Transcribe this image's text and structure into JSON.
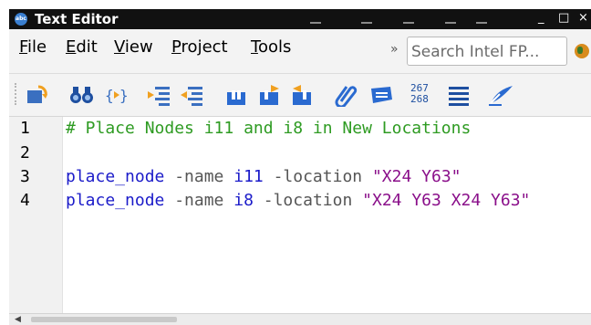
{
  "window": {
    "title": "Text Editor",
    "app_icon_label": "abc",
    "minimize_glyph": "_",
    "maximize_glyph": "□",
    "close_glyph": "×"
  },
  "menu": {
    "items": [
      {
        "underline": "F",
        "rest": "ile"
      },
      {
        "underline": "E",
        "rest": "dit"
      },
      {
        "underline": "V",
        "rest": "iew"
      },
      {
        "underline": "P",
        "rest": "roject"
      },
      {
        "underline": "T",
        "rest": "ools"
      }
    ],
    "overflow_glyph": "»",
    "search_placeholder": "Search Intel FP..."
  },
  "toolbar": {
    "icons": [
      "open-refresh-icon",
      "find-binoculars-icon",
      "braces-icon",
      "indent-icon",
      "outdent-icon",
      "bookmark-icon",
      "bookmark-next-icon",
      "bookmark-prev-icon",
      "attach-paperclip-icon",
      "tag-icon",
      "line-numbers-icon",
      "list-icon",
      "edit-pen-icon"
    ],
    "line_numbers_top": "267",
    "line_numbers_bottom": "268"
  },
  "editor": {
    "line_numbers": [
      "1",
      "2",
      "3",
      "4"
    ],
    "lines": {
      "l1_comment": "# Place Nodes i11 and i8 in New Locations",
      "l3_cmd": "place_node",
      "l3_flag1": " -name ",
      "l3_id": "i11",
      "l3_flag2": " -location ",
      "l3_str": "\"X24 Y63\"",
      "l4_cmd": "place_node",
      "l4_flag1": " -name ",
      "l4_id": "i8",
      "l4_flag2": " -location ",
      "l4_str": "\"X24 Y63 X24 Y63\""
    }
  },
  "scrollbar": {
    "left_arrow_glyph": "◀"
  },
  "colors": {
    "comment": "#2e9b22",
    "command": "#1b1bc9",
    "string": "#8a0f8a",
    "titlebar": "#111111"
  }
}
